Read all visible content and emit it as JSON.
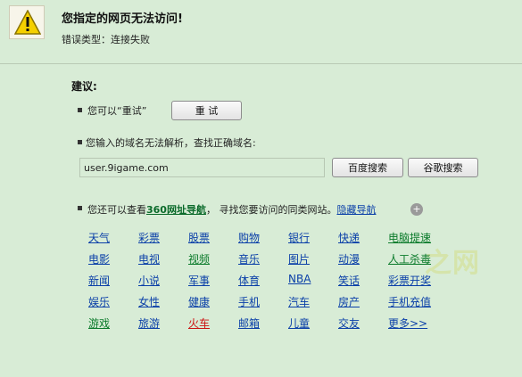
{
  "error": {
    "title": "您指定的网页无法访问!",
    "type_line": "错误类型：连接失败"
  },
  "suggest": {
    "heading": "建议:",
    "retry_text": "您可以“重试”",
    "retry_button": "重 试",
    "dns_text": "您输入的域名无法解析，查找正确域名:",
    "url_value": "user.9igame.com",
    "baidu_button": "百度搜索",
    "google_button": "谷歌搜索",
    "nav_prefix": "您还可以查看",
    "nav_360": "360网址导航",
    "nav_middle": "，  寻找您要访问的同类网站。",
    "nav_hidden": "隐藏导航",
    "add_icon": "plus-circle-icon"
  },
  "links": [
    [
      "天气",
      "彩票",
      "股票",
      "购物",
      "银行",
      "快递",
      "电脑提速"
    ],
    [
      "电影",
      "电视",
      "视频",
      "音乐",
      "图片",
      "动漫",
      "人工杀毒"
    ],
    [
      "新闻",
      "小说",
      "军事",
      "体育",
      "NBA",
      "笑话",
      "彩票开奖"
    ],
    [
      "娱乐",
      "女性",
      "健康",
      "手机",
      "汽车",
      "房产",
      "手机充值"
    ],
    [
      "游戏",
      "旅游",
      "火车",
      "邮箱",
      "儿童",
      "交友",
      "更多>>"
    ]
  ],
  "link_colors": {
    "default": "#0a3fa8",
    "green": "#0a7a2a",
    "red": "#cc1111"
  },
  "watermark": "之网"
}
